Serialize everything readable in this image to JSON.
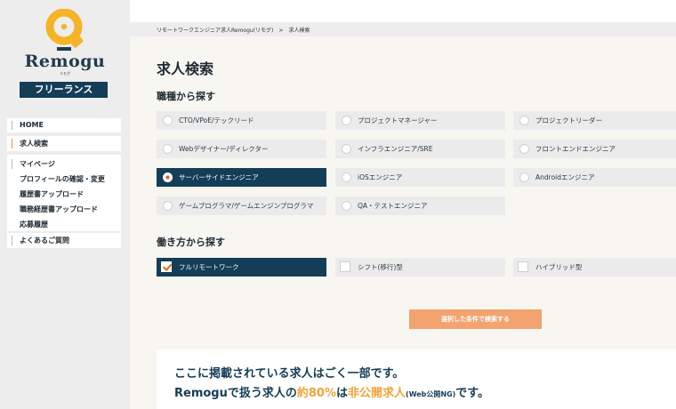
{
  "sidebar": {
    "brand": "Remogu",
    "brand_sub": "リモグ",
    "badge": "フリーランス",
    "nav": {
      "home": "HOME",
      "jobs": "求人検索",
      "mypage": "マイページ",
      "profile": "プロフィールの確認・変更",
      "resume": "履歴書アップロード",
      "cv": "職務経歴書アップロード",
      "history": "応募履歴",
      "faq": "よくあるご質問"
    }
  },
  "breadcrumb": {
    "home": "リモートワークエンジニア求人Remogu(リモグ)",
    "separator": ">",
    "current": "求人検索"
  },
  "page": {
    "title": "求人検索",
    "job_section": "職種から探す",
    "style_section": "働き方から探す"
  },
  "job_types": [
    {
      "label": "CTO/VPoE/テックリード",
      "selected": false
    },
    {
      "label": "プロジェクトマネージャー",
      "selected": false
    },
    {
      "label": "プロジェクトリーダー",
      "selected": false
    },
    {
      "label": "Webデザイナー/ディレクター",
      "selected": false
    },
    {
      "label": "インフラエンジニア/SRE",
      "selected": false
    },
    {
      "label": "フロントエンドエンジニア",
      "selected": false
    },
    {
      "label": "サーバーサイドエンジニア",
      "selected": true
    },
    {
      "label": "iOSエンジニア",
      "selected": false
    },
    {
      "label": "Androidエンジニア",
      "selected": false
    },
    {
      "label": "ゲームプログラマ/ゲームエンジンプログラマ",
      "selected": false
    },
    {
      "label": "QA・テストエンジニア",
      "selected": false
    }
  ],
  "work_styles": [
    {
      "label": "フルリモートワーク",
      "selected": true
    },
    {
      "label": "シフト(移行)型",
      "selected": false
    },
    {
      "label": "ハイブリッド型",
      "selected": false
    }
  ],
  "search_button": "選択した条件で検索する",
  "notice": {
    "line1": "ここに掲載されている求人はごく一部です。",
    "line2_a": "Remoguで扱う求人の",
    "line2_b": "約80%",
    "line2_c": "は",
    "line2_d": "非公開求人",
    "line2_e": "(Web公開NG)",
    "line2_f": "です。"
  },
  "colors": {
    "navy": "#143d57",
    "accent_orange": "#e8600f",
    "button": "#f2a36f",
    "logo_yellow": "#f5b326"
  }
}
